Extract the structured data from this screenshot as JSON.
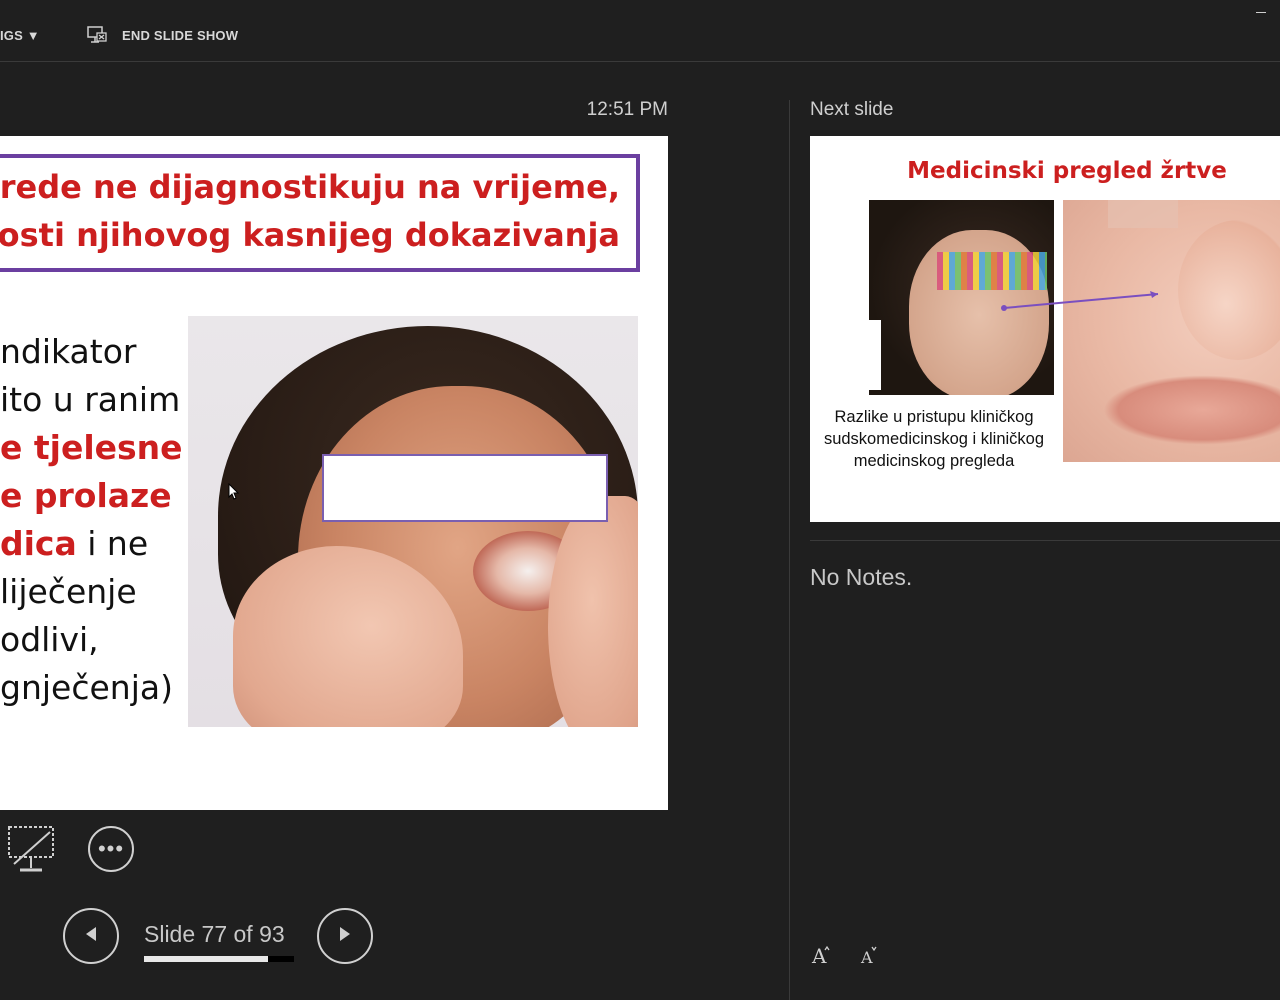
{
  "toolbar": {
    "settings_label": "IGS ▼",
    "end_show_label": "END SLIDE SHOW"
  },
  "presenter": {
    "clock": "12:51 PM",
    "next_slide_label": "Next slide",
    "notes": "No Notes.",
    "slide_counter": "Slide 77 of 93",
    "current_slide_number": 77,
    "total_slides": 93,
    "progress_fraction": 0.828
  },
  "current_slide": {
    "title_line_1": "ovrede ne dijagnostikuju na vrijeme,",
    "title_line_2": "ućnosti njihovog kasnijeg dokazivanja",
    "body": [
      {
        "plain": "ndikator",
        "red": ""
      },
      {
        "plain": "ito u ranim",
        "red": ""
      },
      {
        "plain": "",
        "red": "e tjelesne"
      },
      {
        "plain": "",
        "red": "e prolaze"
      },
      {
        "plain": " i ne",
        "red": "dica"
      },
      {
        "plain": "liječenje",
        "red": ""
      },
      {
        "plain": "odlivi,",
        "red": ""
      },
      {
        "plain": "gnječenja)",
        "red": ""
      }
    ]
  },
  "next_slide": {
    "title": "Medicinski pregled žrtve",
    "caption": "Razlike u pristupu kliničkog sudskomedicinskog i kliničkog medicinskog pregleda"
  },
  "icons": {
    "end_show": "end-slide-show-icon",
    "pen": "screen-pen-icon",
    "more": "more-options-icon",
    "prev": "previous-slide-icon",
    "next": "next-slide-icon",
    "font_up": "increase-font-icon",
    "font_down": "decrease-font-icon"
  },
  "colors": {
    "accent_red": "#cc1f1f",
    "title_border": "#6b3fa0",
    "background": "#1f1f1f"
  }
}
